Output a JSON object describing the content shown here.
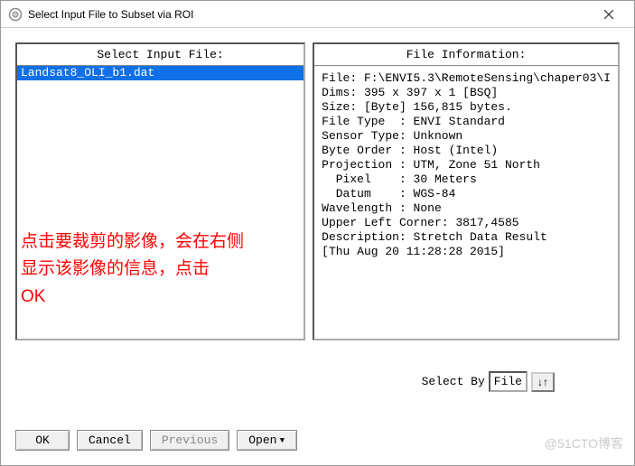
{
  "window": {
    "title": "Select Input File to Subset via ROI"
  },
  "left_panel": {
    "header": "Select Input File:",
    "items": [
      {
        "name": "Landsat8_OLI_b1.dat",
        "selected": true
      }
    ]
  },
  "right_panel": {
    "header": "File Information:",
    "info_text": "File: F:\\ENVI5.3\\RemoteSensing\\chaper03\\I\nDims: 395 x 397 x 1 [BSQ]\nSize: [Byte] 156,815 bytes.\nFile Type  : ENVI Standard\nSensor Type: Unknown\nByte Order : Host (Intel)\nProjection : UTM, Zone 51 North\n  Pixel    : 30 Meters\n  Datum    : WGS-84\nWavelength : None\nUpper Left Corner: 3817,4585\nDescription: Stretch Data Result\n[Thu Aug 20 11:28:28 2015]"
  },
  "annotation": {
    "line1": "点击要裁剪的影像，会在右侧",
    "line2": "显示该影像的信息，点击",
    "line3": "OK"
  },
  "select_by": {
    "label": "Select By",
    "value": "File",
    "sort_icon": "↓↑"
  },
  "buttons": {
    "ok": "OK",
    "cancel": "Cancel",
    "previous": "Previous",
    "open": "Open"
  },
  "watermark": "@51CTO博客"
}
